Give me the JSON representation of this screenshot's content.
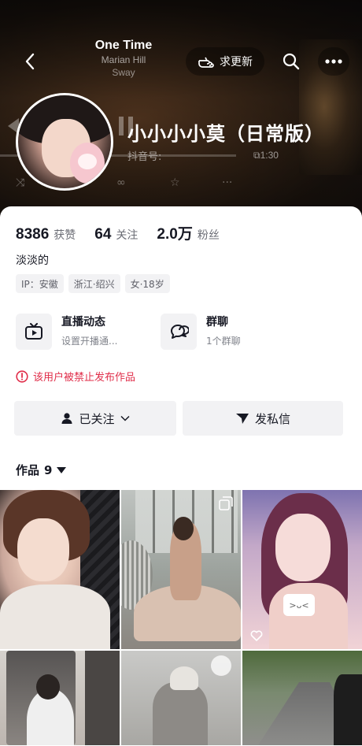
{
  "player": {
    "song_title": "One Time",
    "song_artist": "Marian Hill",
    "song_album": "Sway",
    "time": "1:30"
  },
  "header": {
    "update_label": "求更新",
    "nickname": "小小小小莫（日常版）",
    "douyin_id_label": "抖音号:"
  },
  "stats": [
    {
      "value": "8386",
      "label": "获赞"
    },
    {
      "value": "64",
      "label": "关注"
    },
    {
      "value": "2.0万",
      "label": "粉丝"
    }
  ],
  "bio": "淡淡的",
  "tags": [
    "IP：安徽",
    "浙江·绍兴",
    "女·18岁"
  ],
  "features": {
    "live": {
      "title": "直播动态",
      "subtitle": "设置开播通..."
    },
    "group": {
      "title": "群聊",
      "subtitle": "1个群聊"
    }
  },
  "banned_notice": "该用户被禁止发布作品",
  "actions": {
    "follow_label": "已关注",
    "message_label": "发私信"
  },
  "works": {
    "label": "作品",
    "count": "9"
  },
  "icons": [
    "back-icon",
    "hand-point-icon",
    "search-icon",
    "more-icon",
    "tv-icon",
    "chat-bubble-icon",
    "warning-icon",
    "user-icon",
    "chevron-down-icon",
    "send-icon",
    "caret-down-icon",
    "heart-icon",
    "multi-image-icon"
  ],
  "colors": {
    "accent_red": "#e02e4a",
    "button_bg": "#f2f2f4",
    "text_primary": "#161823"
  }
}
